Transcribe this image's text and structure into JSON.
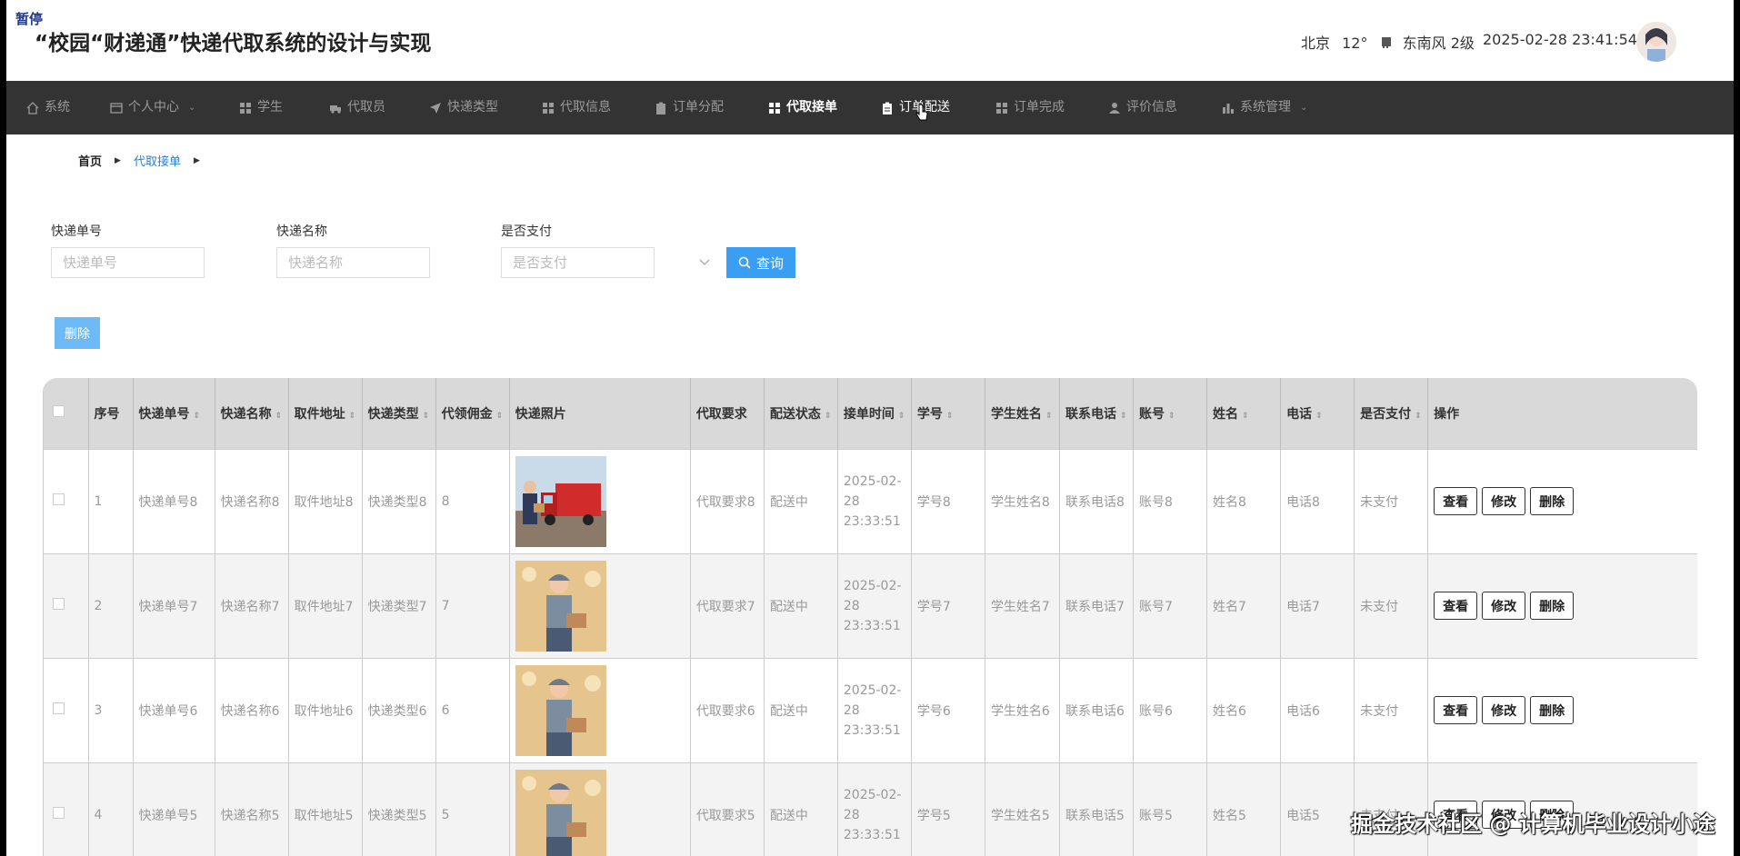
{
  "status_label": "暂停",
  "header": {
    "title": "“校园“财递通”快递代取系统的设计与实现",
    "weather": {
      "city": "北京",
      "temperature": "12°",
      "wind": "东南风 2级",
      "icon": "cloud-icon"
    },
    "datetime": "2025-02-28 23:41:54"
  },
  "nav": {
    "items": [
      {
        "label": "系统",
        "icon": "home-icon"
      },
      {
        "label": "个人中心",
        "icon": "user-card-icon",
        "has_dropdown": true
      },
      {
        "label": "学生",
        "icon": "grid-icon"
      },
      {
        "label": "代取员",
        "icon": "truck-icon"
      },
      {
        "label": "快递类型",
        "icon": "send-icon"
      },
      {
        "label": "代取信息",
        "icon": "grid-icon"
      },
      {
        "label": "订单分配",
        "icon": "clipboard-icon"
      },
      {
        "label": "代取接单",
        "icon": "grid-icon",
        "active": true
      },
      {
        "label": "订单配送",
        "icon": "clipboard-icon",
        "hovered": true
      },
      {
        "label": "订单完成",
        "icon": "grid-icon"
      },
      {
        "label": "评价信息",
        "icon": "person-icon"
      },
      {
        "label": "系统管理",
        "icon": "bar-chart-icon",
        "has_dropdown": true
      }
    ]
  },
  "breadcrumb": {
    "home": "首页",
    "current": "代取接单"
  },
  "search": {
    "tracking_no": {
      "label": "快递单号",
      "placeholder": "快递单号"
    },
    "express_name": {
      "label": "快递名称",
      "placeholder": "快递名称"
    },
    "is_paid": {
      "label": "是否支付",
      "placeholder": "是否支付"
    },
    "query_label": "查询"
  },
  "delete_label": "删除",
  "table": {
    "columns": [
      "序号",
      "快递单号",
      "快递名称",
      "取件地址",
      "快递类型",
      "代领佣金",
      "快递照片",
      "代取要求",
      "配送状态",
      "接单时间",
      "学号",
      "学生姓名",
      "联系电话",
      "账号",
      "姓名",
      "电话",
      "是否支付",
      "操作"
    ],
    "rows": [
      {
        "index": "1",
        "tracking_no": "快递单号8",
        "name": "快递名称8",
        "address": "取件地址8",
        "type": "快递类型8",
        "commission": "8",
        "requirement": "代取要求8",
        "status": "配送中",
        "time": "2025-02-28 23:33:51",
        "student_no": "学号8",
        "student_name": "学生姓名8",
        "contact": "联系电话8",
        "account": "账号8",
        "person": "姓名8",
        "phone": "电话8",
        "paid": "未支付",
        "photo": "truck-photo"
      },
      {
        "index": "2",
        "tracking_no": "快递单号7",
        "name": "快递名称7",
        "address": "取件地址7",
        "type": "快递类型7",
        "commission": "7",
        "requirement": "代取要求7",
        "status": "配送中",
        "time": "2025-02-28 23:33:51",
        "student_no": "学号7",
        "student_name": "学生姓名7",
        "contact": "联系电话7",
        "account": "账号7",
        "person": "姓名7",
        "phone": "电话7",
        "paid": "未支付",
        "photo": "courier-photo"
      },
      {
        "index": "3",
        "tracking_no": "快递单号6",
        "name": "快递名称6",
        "address": "取件地址6",
        "type": "快递类型6",
        "commission": "6",
        "requirement": "代取要求6",
        "status": "配送中",
        "time": "2025-02-28 23:33:51",
        "student_no": "学号6",
        "student_name": "学生姓名6",
        "contact": "联系电话6",
        "account": "账号6",
        "person": "姓名6",
        "phone": "电话6",
        "paid": "未支付",
        "photo": "courier-photo"
      },
      {
        "index": "4",
        "tracking_no": "快递单号5",
        "name": "快递名称5",
        "address": "取件地址5",
        "type": "快递类型5",
        "commission": "5",
        "requirement": "代取要求5",
        "status": "配送中",
        "time": "2025-02-28 23:33:51",
        "student_no": "学号5",
        "student_name": "学生姓名5",
        "contact": "联系电话5",
        "account": "账号5",
        "person": "姓名5",
        "phone": "电话5",
        "paid": "未支付",
        "photo": "courier-photo"
      }
    ],
    "row_actions": {
      "view": "查看",
      "edit": "修改",
      "delete": "删除"
    }
  },
  "watermark": "掘金技术社区 @ 计算机毕业设计小途",
  "colors": {
    "navbar": "#333333",
    "accent": "#3a9ff3",
    "breadcrumb_active": "#2a7fd0"
  }
}
